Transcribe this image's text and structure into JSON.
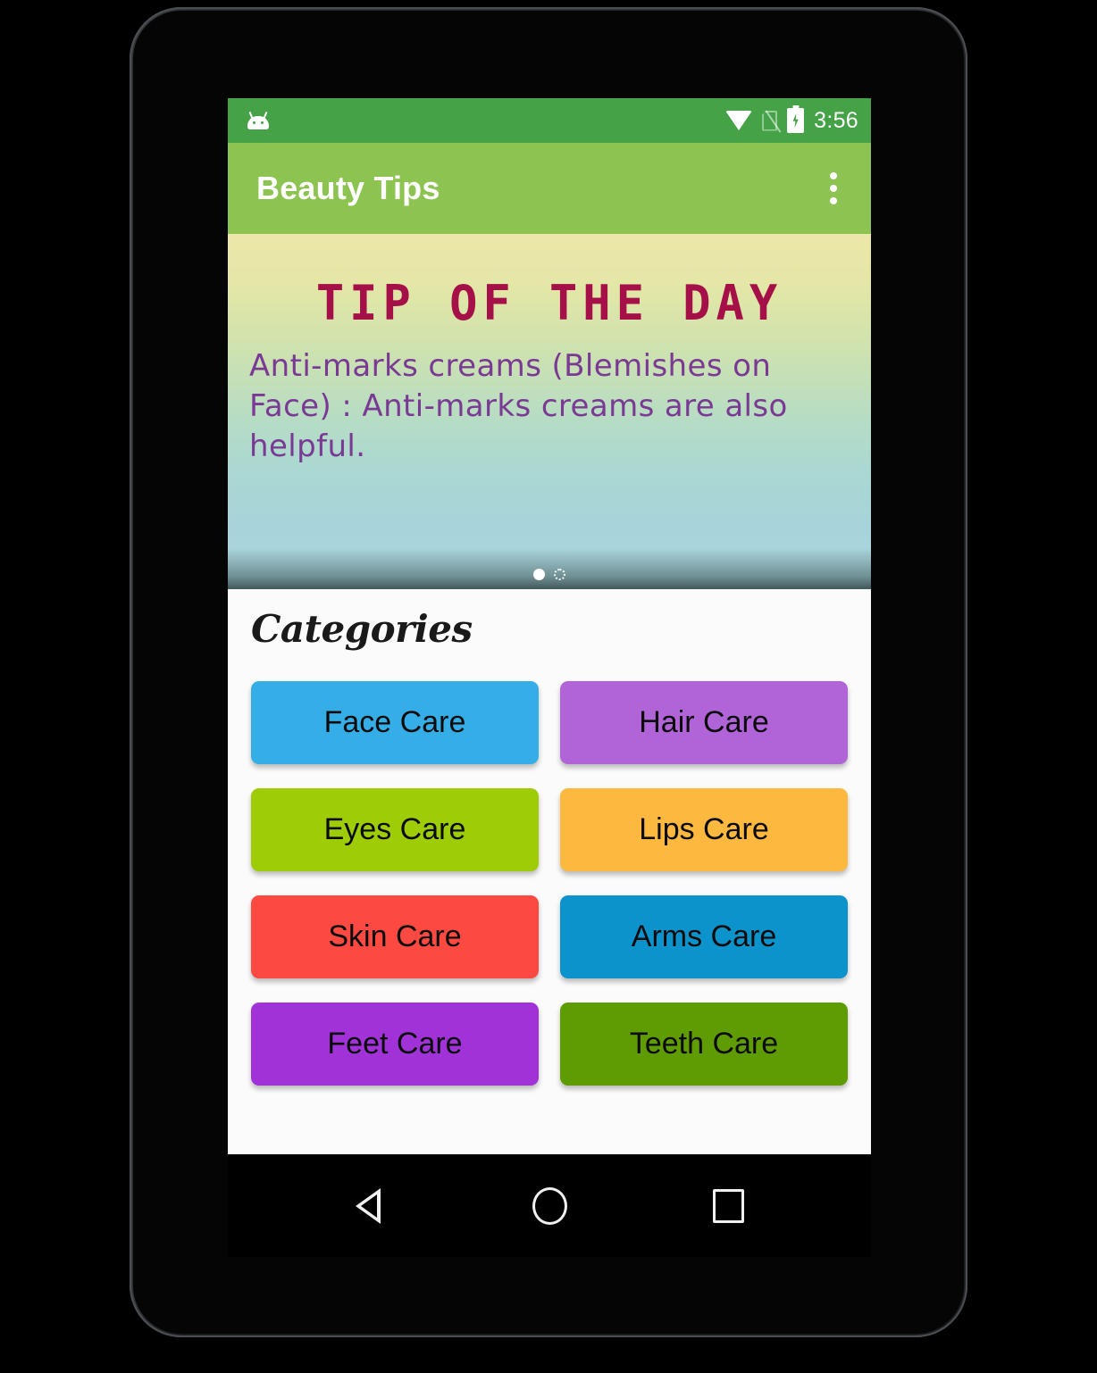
{
  "status_bar": {
    "app_icon": "android-robot-icon",
    "wifi_icon": "wifi-icon",
    "sim_icon": "no-sim-icon",
    "battery_icon": "battery-charging-icon",
    "time": "3:56"
  },
  "app_bar": {
    "title": "Beauty Tips",
    "overflow_icon": "overflow-menu-icon"
  },
  "tip_banner": {
    "title": "TIP OF THE DAY",
    "text": "Anti-marks creams (Blemishes on Face) : Anti-marks creams are also helpful.",
    "title_color": "#a61048",
    "text_color": "#7a3a94",
    "page_dots": [
      {
        "active": true
      },
      {
        "active": false
      }
    ]
  },
  "categories": {
    "heading": "Categories",
    "items": [
      {
        "label": "Face Care",
        "color": "#35aee8"
      },
      {
        "label": "Hair Care",
        "color": "#b163d8"
      },
      {
        "label": "Eyes Care",
        "color": "#9ecc07"
      },
      {
        "label": "Lips Care",
        "color": "#fcb83f"
      },
      {
        "label": "Skin Care",
        "color": "#fc4a43"
      },
      {
        "label": "Arms Care",
        "color": "#0d93cc"
      },
      {
        "label": "Feet Care",
        "color": "#a032d8"
      },
      {
        "label": "Teeth Care",
        "color": "#5f9b02"
      }
    ]
  },
  "nav_bar": {
    "back": "back-icon",
    "home": "home-icon",
    "recents": "recents-icon"
  }
}
